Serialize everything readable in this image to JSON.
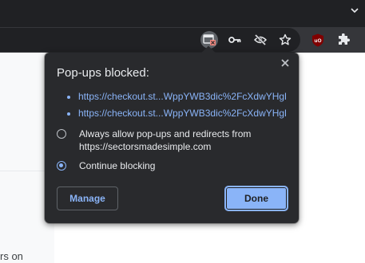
{
  "popup": {
    "title": "Pop-ups blocked:",
    "links": [
      "https://checkout.st...WppYWB3dic%2FcXdwYHgl",
      "https://checkout.st...WppYWB3dic%2FcXdwYHgl"
    ],
    "options": [
      {
        "label": "Always allow pop-ups and redirects from https://sectorsmadesimple.com",
        "selected": false
      },
      {
        "label": "Continue blocking",
        "selected": true
      }
    ],
    "manage_label": "Manage",
    "done_label": "Done"
  },
  "page": {
    "bottom_text": "rs on"
  },
  "toolbar": {
    "icons": [
      "popup-blocked-icon",
      "key-icon",
      "eye-slash-icon",
      "star-icon",
      "ublock-icon",
      "extensions-puzzle-icon"
    ]
  },
  "colors": {
    "accent": "#8ab4f8",
    "popup_bg": "#292a2d",
    "toolbar_bg": "#35363a",
    "ublock_red": "#800000"
  }
}
